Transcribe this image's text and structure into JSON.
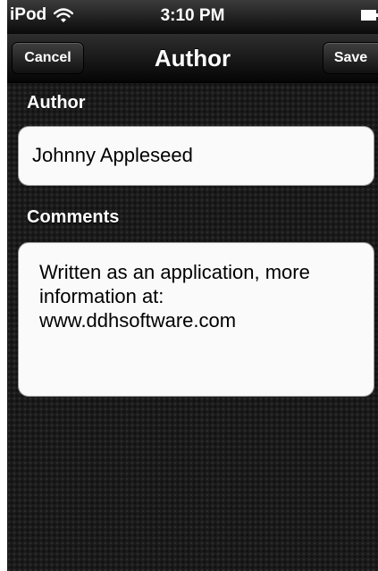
{
  "status_bar": {
    "carrier": "iPod",
    "time": "3:10 PM",
    "wifi_icon": "wifi-icon",
    "battery_icon": "battery-full-icon"
  },
  "nav_bar": {
    "title": "Author",
    "cancel_label": "Cancel",
    "save_label": "Save"
  },
  "author_section": {
    "label": "Author",
    "value": "Johnny Appleseed"
  },
  "comments_section": {
    "label": "Comments",
    "lines": [
      "Written as an application, more",
      "information at:",
      "www.ddhsoftware.com"
    ]
  },
  "colors": {
    "background": "#1a1a1a",
    "bar_dark": "#050505",
    "field_background": "#fafafa",
    "text_light": "#ffffff"
  }
}
